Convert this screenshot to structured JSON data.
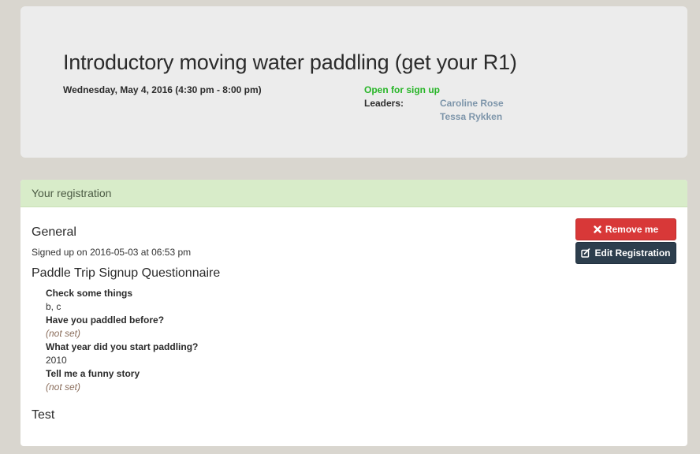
{
  "event": {
    "title": "Introductory moving water paddling (get your R1)",
    "date": "Wednesday, May 4, 2016 (4:30 pm - 8:00 pm)",
    "status": "Open for sign up",
    "leaders_label": "Leaders:",
    "leaders": [
      "Caroline Rose",
      "Tessa Rykken"
    ],
    "status_color": "#27b527",
    "leader_link_color": "#7d95aa"
  },
  "registration": {
    "heading": "Your registration",
    "general_title": "General",
    "signed_up_text": "Signed up on 2016-05-03 at 06:53 pm",
    "questionnaire_title": "Paddle Trip Signup Questionnaire",
    "questions": [
      {
        "question": "Check some things",
        "answer": "b, c"
      },
      {
        "question": "Have you paddled before?",
        "answer": "(not set)"
      },
      {
        "question": "What year did you start paddling?",
        "answer": "2010"
      },
      {
        "question": "Tell me a funny story",
        "answer": "(not set)"
      }
    ],
    "test_title": "Test",
    "buttons": {
      "remove_label": "Remove me",
      "remove_icon": "close-icon",
      "edit_label": "Edit Registration",
      "edit_icon": "edit-icon"
    },
    "heading_bg_color": "#d8ecc9",
    "remove_button_color": "#d83838",
    "edit_button_color": "#2d3e4d"
  }
}
